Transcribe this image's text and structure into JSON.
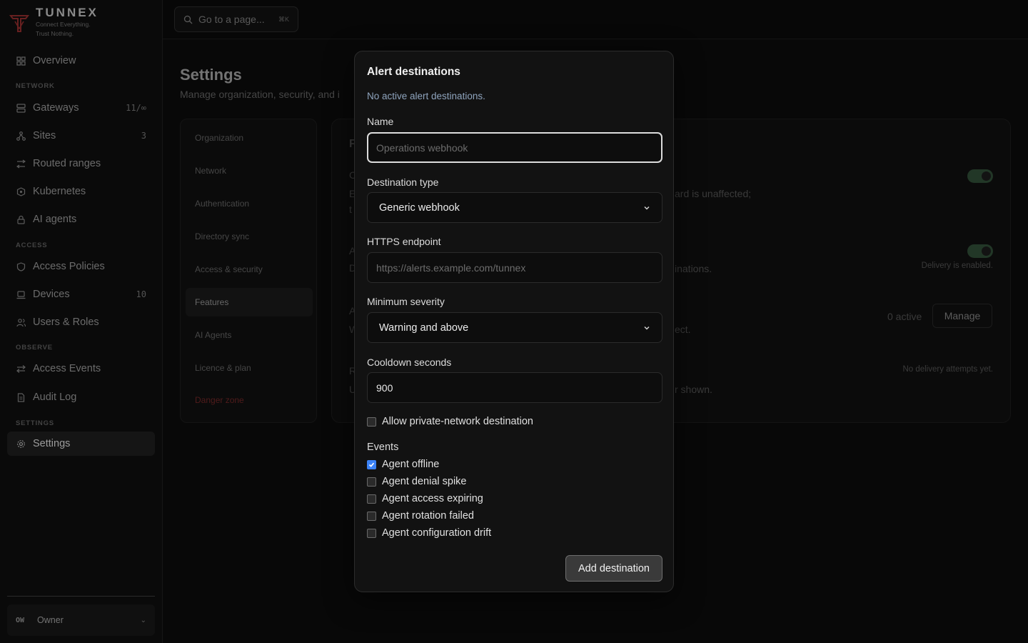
{
  "brand": {
    "name": "TUNNEX",
    "tagline_line1": "Connect Everything.",
    "tagline_line2": "Trust Nothing."
  },
  "search": {
    "placeholder": "Go to a page...",
    "shortcut": "⌘K"
  },
  "sidebar": {
    "overview": "Overview",
    "sections": {
      "network": "NETWORK",
      "access": "ACCESS",
      "observe": "OBSERVE",
      "settings": "SETTINGS"
    },
    "items": {
      "gateways": {
        "label": "Gateways",
        "count": "11/∞"
      },
      "sites": {
        "label": "Sites",
        "count": "3"
      },
      "routed_ranges": {
        "label": "Routed ranges"
      },
      "kubernetes": {
        "label": "Kubernetes"
      },
      "ai_agents": {
        "label": "AI agents"
      },
      "access_policies": {
        "label": "Access Policies"
      },
      "devices": {
        "label": "Devices",
        "count": "10"
      },
      "users_roles": {
        "label": "Users & Roles"
      },
      "access_events": {
        "label": "Access Events"
      },
      "audit_log": {
        "label": "Audit Log"
      },
      "settings": {
        "label": "Settings"
      }
    },
    "owner": {
      "initials": "OW",
      "label": "Owner"
    }
  },
  "page": {
    "title": "Settings",
    "subtitle": "Manage organization, security, and i"
  },
  "subnav": [
    "Organization",
    "Network",
    "Authentication",
    "Directory sync",
    "Access & security",
    "Features",
    "AI Agents",
    "Licence & plan",
    "Danger zone"
  ],
  "background_card": {
    "frag_title": "F",
    "frag_c": "C",
    "frag_e": "E",
    "frag_t": "t",
    "frag_a1": "A",
    "frag_d": "D",
    "frag_a2": "A",
    "frag_w": "W",
    "frag_r": "R",
    "frag_u": "U",
    "text_unaffected": "ard is unaffected;",
    "text_nations": "inations.",
    "text_ect": "ect.",
    "text_shown": "r shown.",
    "delivery_enabled": "Delivery is enabled.",
    "active_count": "0 active",
    "manage_label": "Manage",
    "no_attempts": "No delivery attempts yet."
  },
  "modal": {
    "title": "Alert destinations",
    "description": "No active alert destinations.",
    "name_label": "Name",
    "name_placeholder": "Operations webhook",
    "type_label": "Destination type",
    "type_value": "Generic webhook",
    "endpoint_label": "HTTPS endpoint",
    "endpoint_placeholder": "https://alerts.example.com/tunnex",
    "severity_label": "Minimum severity",
    "severity_value": "Warning and above",
    "cooldown_label": "Cooldown seconds",
    "cooldown_value": "900",
    "private_network_label": "Allow private-network destination",
    "events_label": "Events",
    "events": [
      {
        "label": "Agent offline",
        "checked": true
      },
      {
        "label": "Agent denial spike",
        "checked": false
      },
      {
        "label": "Agent access expiring",
        "checked": false
      },
      {
        "label": "Agent rotation failed",
        "checked": false
      },
      {
        "label": "Agent configuration drift",
        "checked": false
      }
    ],
    "submit_label": "Add destination"
  },
  "colors": {
    "accent": "#3b82f6",
    "toggle_on": "#2e4a34",
    "danger": "#6a2424"
  }
}
